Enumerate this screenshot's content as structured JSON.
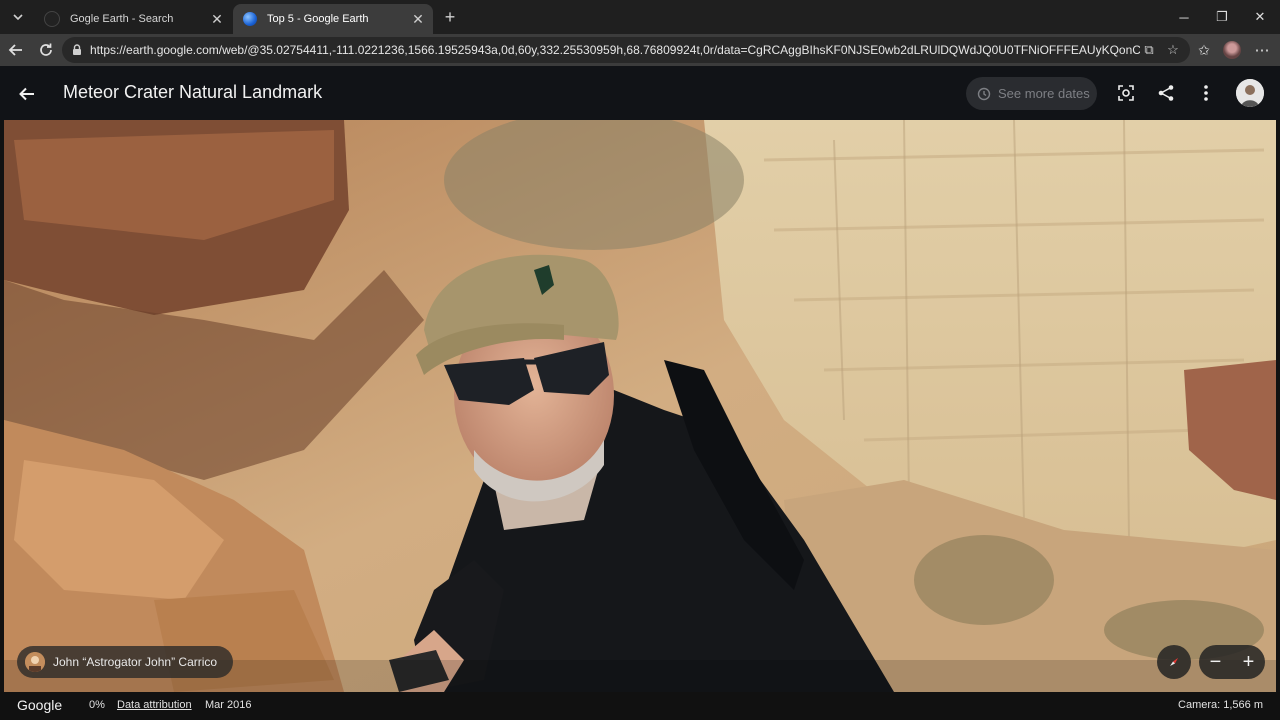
{
  "browser": {
    "tabs": [
      {
        "title": "Gogle Earth - Search",
        "active": false
      },
      {
        "title": "Top 5 - Google Earth",
        "active": true
      }
    ],
    "url": "https://earth.google.com/web/@35.02754411,-111.0221236,1566.19525943a,0d,60y,332.25530959h,68.76809924t,0r/data=CgRCAggBIhsKF0NJSE0wb2dLRUlDQWdJQ0U0TFNiOFFFEAUyKQonCiUKITFBb..."
  },
  "app": {
    "title": "Meteor Crater Natural Landmark",
    "see_more_dates": "See more dates",
    "contributor": "John “Astrogator John” Carrico",
    "status": {
      "logo": "Google",
      "loading": "0%",
      "data_attribution": "Data attribution",
      "date": "Mar 2016",
      "camera": "Camera: 1,566 m"
    },
    "zoom_out": "−",
    "zoom_in": "+"
  },
  "icons": {
    "back": "arrow-left-icon",
    "history": "history-icon",
    "screenshot": "capture-icon",
    "share": "share-icon",
    "more": "more-vert-icon",
    "compass": "compass-icon"
  },
  "colors": {
    "appbar": "#111317",
    "chip": "#2a2c30",
    "compass_red": "#e53935"
  }
}
